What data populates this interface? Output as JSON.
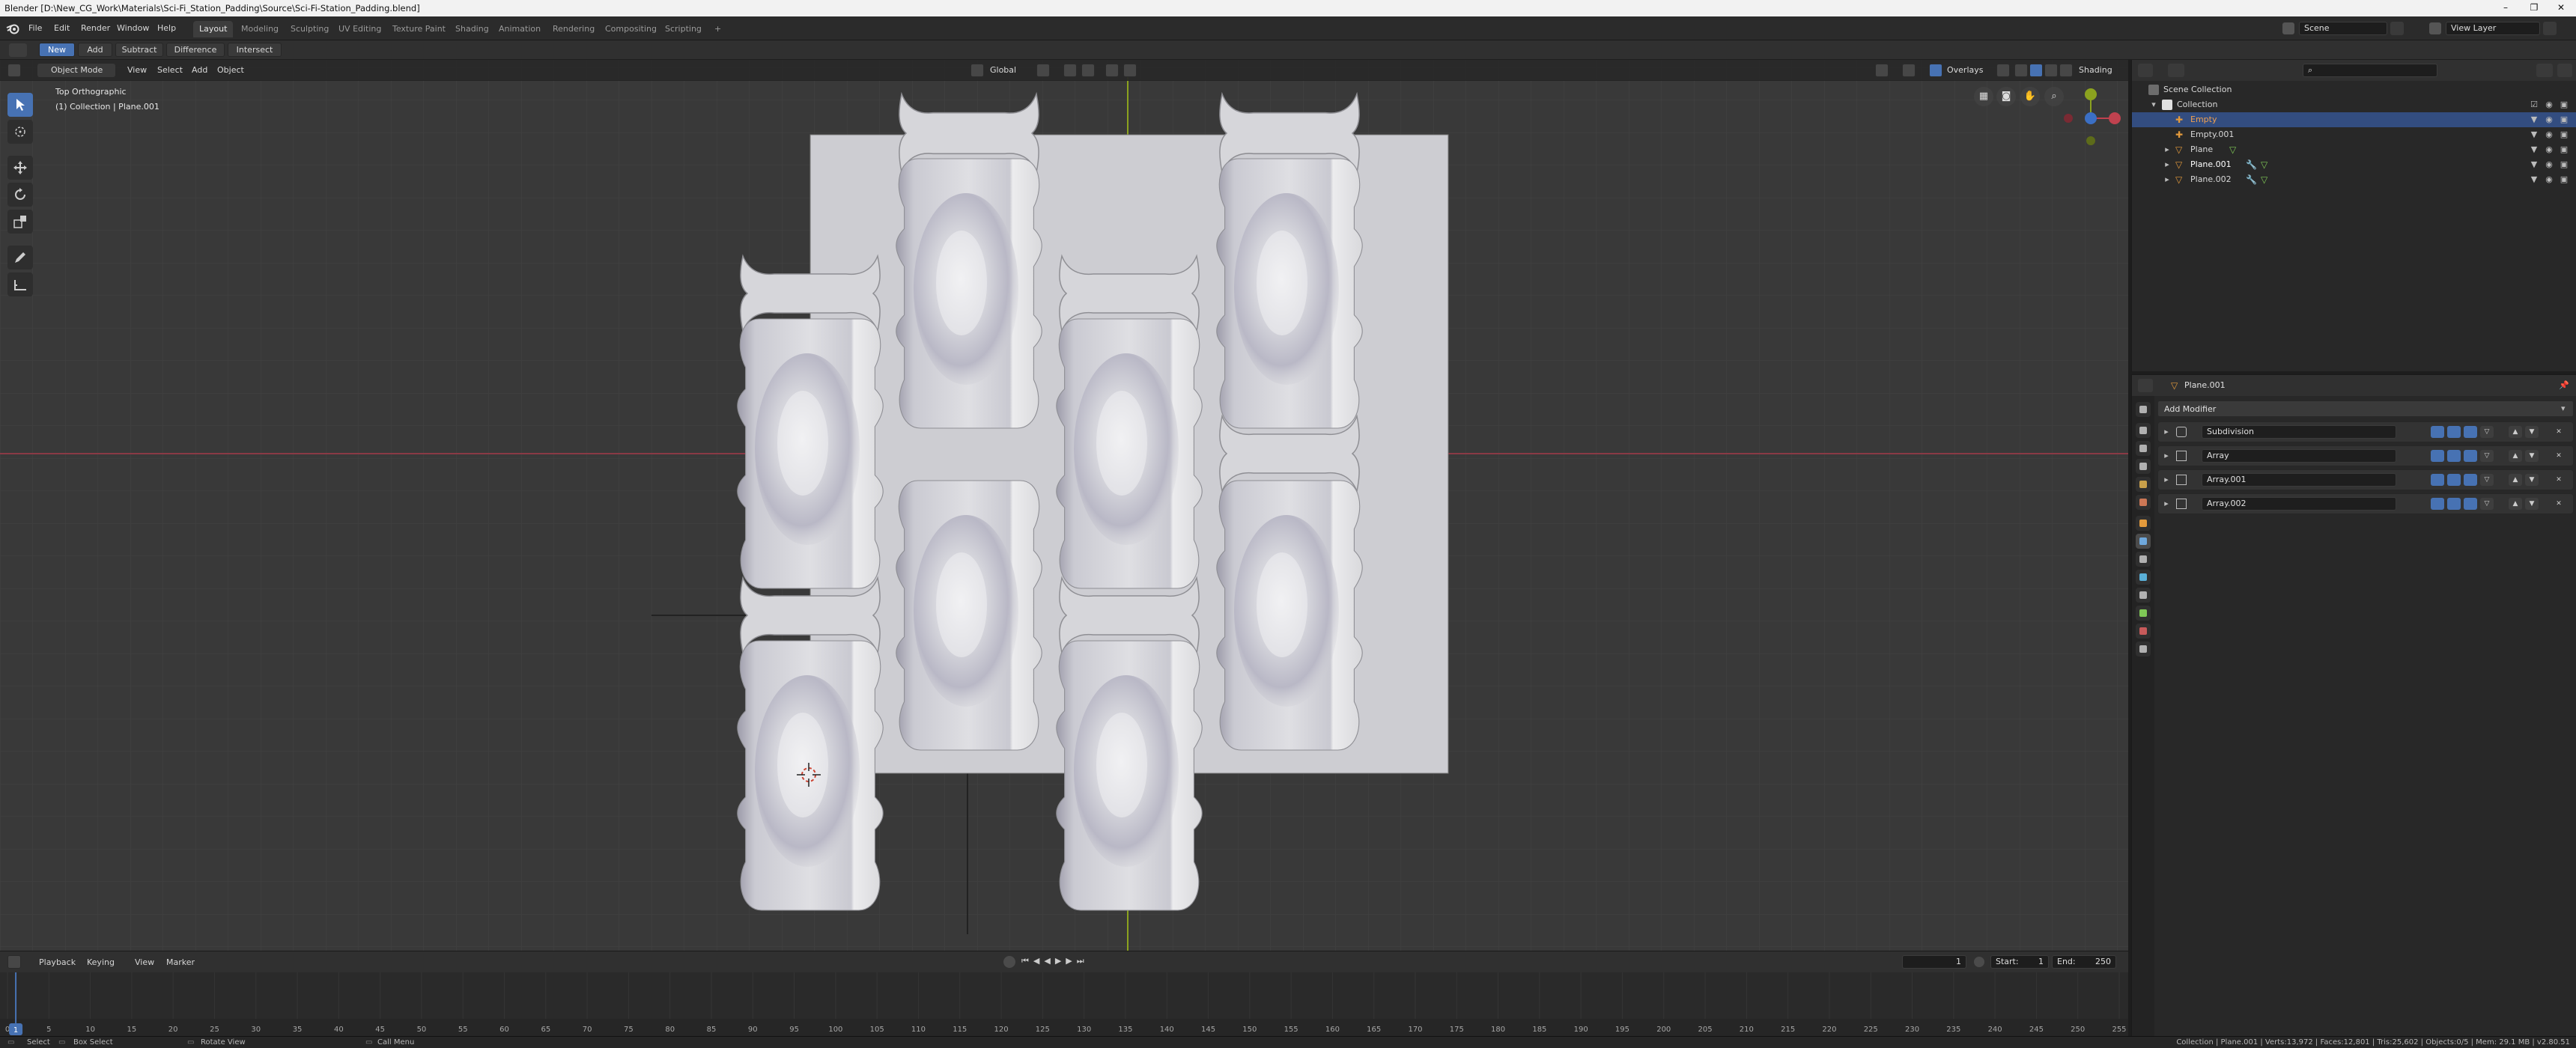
{
  "window": {
    "title": "Blender [D:\\New_CG_Work\\Materials\\Sci-Fi_Station_Padding\\Source\\Sci-Fi-Station_Padding.blend]",
    "minimize": "–",
    "maximize": "❐",
    "close": "✕"
  },
  "menu": [
    "File",
    "Edit",
    "Render",
    "Window",
    "Help"
  ],
  "workspaces": [
    "Layout",
    "Modeling",
    "Sculpting",
    "UV Editing",
    "Texture Paint",
    "Shading",
    "Animation",
    "Rendering",
    "Compositing",
    "Scripting",
    "+"
  ],
  "scene": {
    "name": "Scene",
    "view_layer": "View Layer"
  },
  "bool_tool": [
    "New",
    "Add",
    "Subtract",
    "Difference",
    "Intersect"
  ],
  "viewport": {
    "mode": "Object Mode",
    "menus": [
      "View",
      "Select",
      "Add",
      "Object"
    ],
    "transform_orientation": "Global",
    "overlays": "Overlays",
    "shading": "Shading",
    "view_name": "Top Orthographic",
    "collection_info": "(1) Collection | Plane.001"
  },
  "outliner": {
    "search_placeholder": "",
    "items": [
      {
        "label": "Scene Collection",
        "type": "scene-collection"
      },
      {
        "label": "Collection",
        "type": "collection"
      },
      {
        "label": "Empty",
        "type": "empty",
        "selected": true
      },
      {
        "label": "Empty.001",
        "type": "empty"
      },
      {
        "label": "Plane",
        "type": "mesh"
      },
      {
        "label": "Plane.001",
        "type": "mesh"
      },
      {
        "label": "Plane.002",
        "type": "mesh"
      }
    ]
  },
  "properties": {
    "object_name": "Plane.001",
    "add_modifier": "Add Modifier",
    "modifiers": [
      "Subdivision",
      "Array",
      "Array.001",
      "Array.002"
    ]
  },
  "timeline": {
    "menus": [
      "Playback",
      "Keying",
      "View",
      "Marker"
    ],
    "current_frame": "1",
    "start_label": "Start:",
    "start": "1",
    "end_label": "End:",
    "end": "250",
    "ticks": [
      0,
      5,
      10,
      15,
      20,
      25,
      30,
      35,
      40,
      45,
      50,
      55,
      60,
      65,
      70,
      75,
      80,
      85,
      90,
      95,
      100,
      105,
      110,
      115,
      120,
      125,
      130,
      135,
      140,
      145,
      150,
      155,
      160,
      165,
      170,
      175,
      180,
      185,
      190,
      195,
      200,
      205,
      210,
      215,
      220,
      225,
      230,
      235,
      240,
      245,
      250,
      255
    ]
  },
  "status": {
    "select": "Select",
    "box_select": "Box Select",
    "rotate_view": "Rotate View",
    "call_menu": "Call Menu",
    "stats": "Collection | Plane.001 | Verts:13,972 | Faces:12,801 | Tris:25,602 | Objects:0/5 | Mem: 29.1 MB | v2.80.51"
  },
  "colors": {
    "accent": "#4772b3",
    "x_axis": "#a33e4a",
    "y_axis": "#8ba21f",
    "pad": "#d4d4d8"
  }
}
